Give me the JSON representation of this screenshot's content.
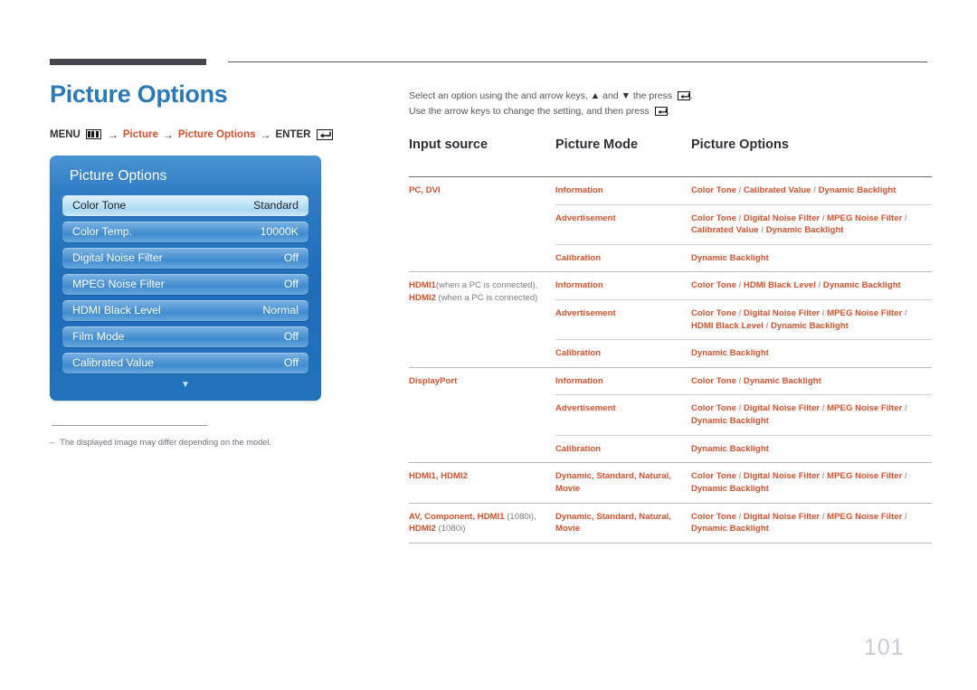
{
  "page": {
    "title": "Picture Options",
    "number": "101"
  },
  "breadcrumb": {
    "menu_label": "MENU",
    "menu_icon": "menu-bars-icon",
    "arrow": "→",
    "item1": "Picture",
    "item2": "Picture Options",
    "enter_label": "ENTER",
    "enter_icon": "enter-return-icon"
  },
  "osd": {
    "title": "Picture Options",
    "down_arrow": "▼",
    "rows": [
      {
        "label": "Color Tone",
        "value": "Standard",
        "selected": true
      },
      {
        "label": "Color Temp.",
        "value": "10000K",
        "selected": false
      },
      {
        "label": "Digital Noise Filter",
        "value": "Off",
        "selected": false
      },
      {
        "label": "MPEG Noise Filter",
        "value": "Off",
        "selected": false
      },
      {
        "label": "HDMI Black Level",
        "value": "Normal",
        "selected": false
      },
      {
        "label": "Film Mode",
        "value": "Off",
        "selected": false
      },
      {
        "label": "Calibrated Value",
        "value": "Off",
        "selected": false
      }
    ]
  },
  "footnote": {
    "dash": "‒",
    "text": "The displayed image may differ depending on the model."
  },
  "intro": {
    "line1_a": "Select an option using the and arrow keys, ",
    "line1_up": "▲",
    "line1_b": " and ",
    "line1_down": "▼",
    "line1_c": " the press ",
    "line1_d": ".",
    "line2_a": "Use the arrow keys to change the setting, and then press ",
    "line2_b": "."
  },
  "table": {
    "headers": [
      "Input source",
      "Picture Mode",
      "Picture Options"
    ],
    "groups": [
      {
        "source": "PC, DVI",
        "source_note": "",
        "rows": [
          {
            "mode": "Information",
            "options": "Color Tone / Calibrated Value / Dynamic Backlight"
          },
          {
            "mode": "Advertisement",
            "options": "Color Tone / Digital Noise Filter / MPEG Noise Filter / Calibrated Value / Dynamic Backlight"
          },
          {
            "mode": "Calibration",
            "options": "Dynamic Backlight"
          }
        ]
      },
      {
        "source": "HDMI1",
        "source_note": "(when a PC is connected),",
        "source2": "HDMI2",
        "source_note2": "(when a PC is connected)",
        "rows": [
          {
            "mode": "Information",
            "options": "Color Tone / HDMI Black Level / Dynamic Backlight"
          },
          {
            "mode": "Advertisement",
            "options": "Color Tone / Digital Noise Filter / MPEG Noise Filter / HDMI Black Level / Dynamic Backlight"
          },
          {
            "mode": "Calibration",
            "options": "Dynamic Backlight"
          }
        ]
      },
      {
        "source": "DisplayPort",
        "source_note": "",
        "rows": [
          {
            "mode": "Information",
            "options": "Color Tone / Dynamic Backlight"
          },
          {
            "mode": "Advertisement",
            "options": "Color Tone / Digital Noise Filter / MPEG Noise Filter / Dynamic Backlight"
          },
          {
            "mode": "Calibration",
            "options": "Dynamic Backlight"
          }
        ]
      },
      {
        "source": "HDMI1, HDMI2",
        "source_note": "",
        "rows": [
          {
            "mode": "Dynamic, Standard, Natural, Movie",
            "options": "Color Tone / Digital Noise Filter / MPEG Noise Filter / Dynamic Backlight"
          }
        ]
      },
      {
        "source": "AV, Component, HDMI1",
        "source_note": "(1080i),",
        "source2": "HDMI2",
        "source_note2": "(1080i)",
        "rows": [
          {
            "mode": "Dynamic, Standard, Natural, Movie",
            "options": "Color Tone / Digital Noise Filter / MPEG Noise Filter / Dynamic Backlight"
          }
        ]
      }
    ]
  },
  "colors": {
    "accent_blue": "#2b7ab8",
    "accent_orange": "#d9512c",
    "rule_dark": "#45454f",
    "page_number": "#c9c9da"
  }
}
